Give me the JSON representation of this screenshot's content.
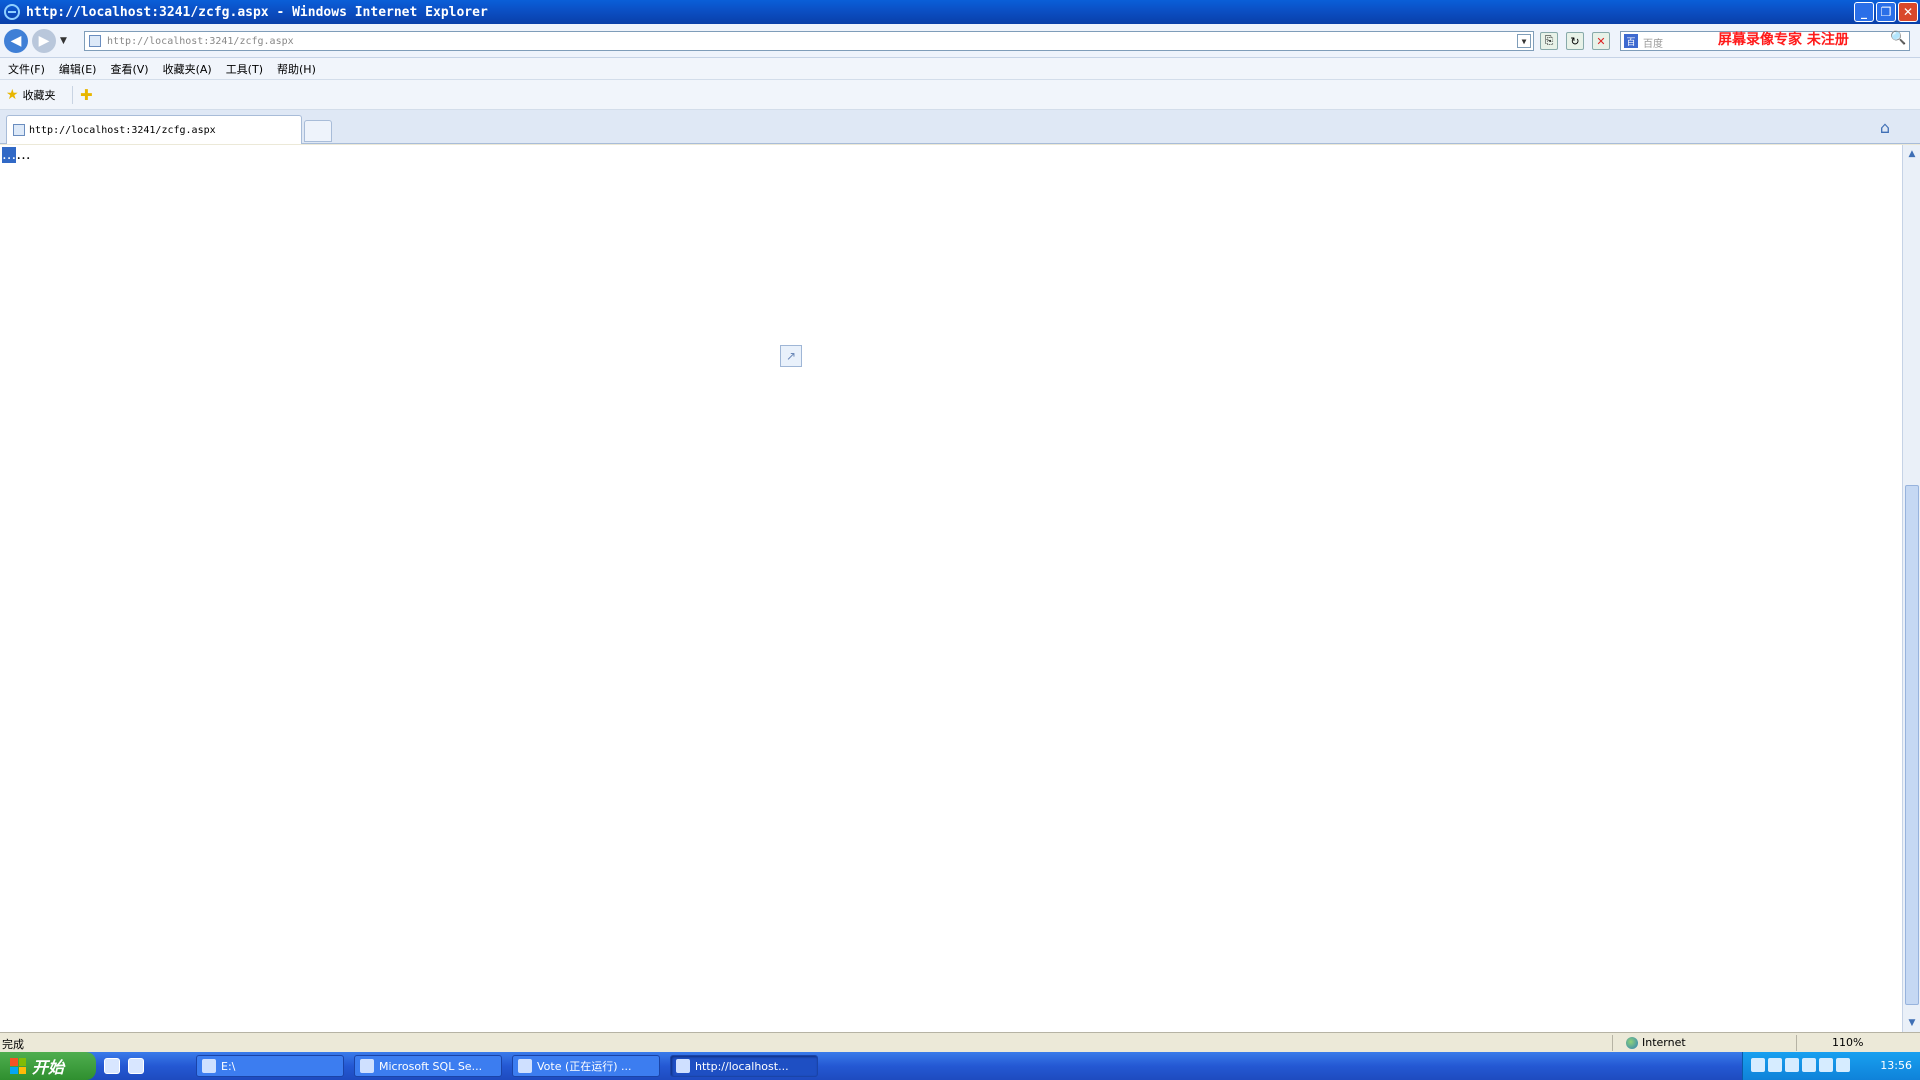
{
  "window": {
    "title": "http://localhost:3241/zcfg.aspx - Windows Internet Explorer"
  },
  "address": {
    "url": "http://localhost:3241/zcfg.aspx"
  },
  "search": {
    "placeholder": "百度",
    "watermark": "屏幕录像专家 未注册"
  },
  "menu": [
    "文件(F)",
    "编辑(E)",
    "查看(V)",
    "收藏夹(A)",
    "工具(T)",
    "帮助(H)"
  ],
  "favorites": {
    "label": "收藏夹"
  },
  "tabs": [
    {
      "label": "http://localhost:3241/zcfg.aspx"
    }
  ],
  "content": {
    "selected_text": "…",
    "body_text": "…"
  },
  "status": {
    "text": "完成",
    "zone": "Internet",
    "zoom": "110%"
  },
  "taskbar": {
    "start": "开始",
    "tasks": [
      {
        "label": "E:\\"
      },
      {
        "label": "Microsoft SQL Se..."
      },
      {
        "label": "Vote (正在运行) ..."
      },
      {
        "label": "http://localhost..."
      }
    ],
    "clock": "13:56"
  }
}
